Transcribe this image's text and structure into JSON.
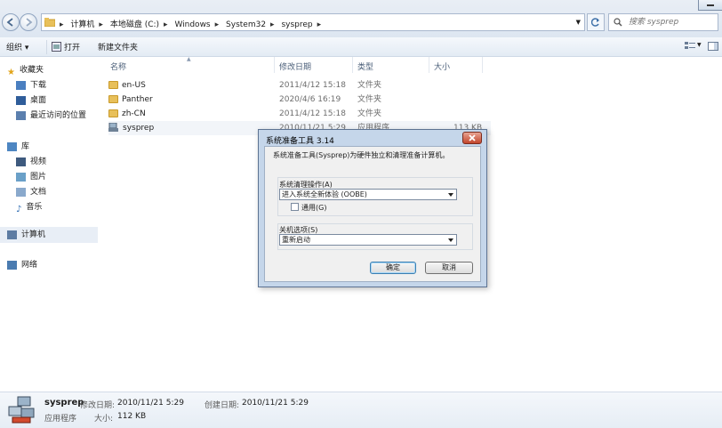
{
  "address": {
    "crumbs": [
      "计算机",
      "本地磁盘 (C:)",
      "Windows",
      "System32",
      "sysprep"
    ],
    "search_placeholder": "搜索 sysprep"
  },
  "toolbar": {
    "organize": "组织 ▾",
    "open": "打开",
    "new_folder": "新建文件夹"
  },
  "nav": {
    "favorites": "收藏夹",
    "fav_items": [
      "下载",
      "桌面",
      "最近访问的位置"
    ],
    "libraries": "库",
    "lib_items": [
      "视频",
      "图片",
      "文档",
      "音乐"
    ],
    "computer": "计算机",
    "network": "网络"
  },
  "columns": {
    "name": "名称",
    "modified": "修改日期",
    "type": "类型",
    "size": "大小"
  },
  "files": [
    {
      "name": "en-US",
      "modified": "2011/4/12 15:18",
      "type": "文件夹",
      "size": ""
    },
    {
      "name": "Panther",
      "modified": "2020/4/6 16:19",
      "type": "文件夹",
      "size": ""
    },
    {
      "name": "zh-CN",
      "modified": "2011/4/12 15:18",
      "type": "文件夹",
      "size": ""
    },
    {
      "name": "sysprep",
      "modified": "2010/11/21 5:29",
      "type": "应用程序",
      "size": "113 KB"
    }
  ],
  "details": {
    "name": "sysprep",
    "type": "应用程序",
    "modified_label": "修改日期:",
    "modified": "2010/11/21 5:29",
    "created_label": "创建日期:",
    "created": "2010/11/21 5:29",
    "size_label": "大小:",
    "size": "112 KB"
  },
  "dialog": {
    "title": "系统准备工具 3.14",
    "description": "系统准备工具(Sysprep)为硬件独立和清理准备计算机。",
    "cleanup_label": "系统清理操作(A)",
    "cleanup_value": "进入系统全新体验 (OOBE)",
    "generalize_label": "通用(G)",
    "shutdown_label": "关机选项(S)",
    "shutdown_value": "重新启动",
    "ok": "确定",
    "cancel": "取消"
  }
}
